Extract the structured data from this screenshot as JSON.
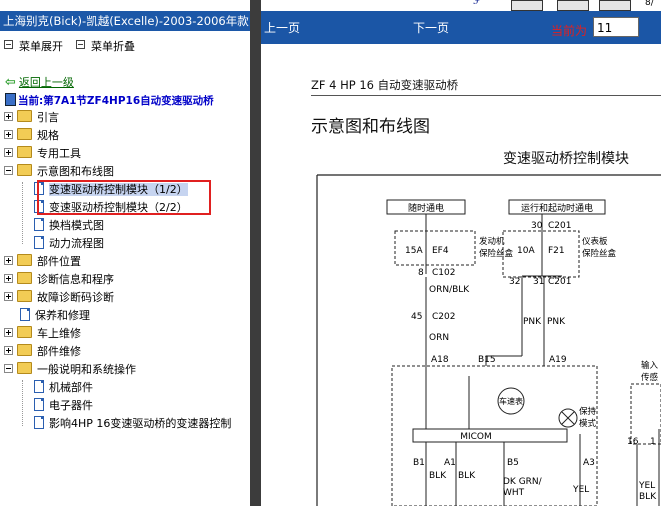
{
  "window_title": "上海别克(Bick)-凯越(Excelle)-2003-2006年款",
  "menu": {
    "expand": "菜单展开",
    "collapse": "菜单折叠"
  },
  "back_link": "返回上一级",
  "current": "当前:第7A1节ZF4HP16自动变速驱动桥",
  "tree": [
    {
      "label": "引言",
      "type": "folder",
      "expanded": false
    },
    {
      "label": "规格",
      "type": "folder",
      "expanded": false
    },
    {
      "label": "专用工具",
      "type": "folder",
      "expanded": false
    },
    {
      "label": "示意图和布线图",
      "type": "folder",
      "expanded": true
    },
    {
      "label": "变速驱动桥控制模块（1/2）",
      "type": "doc",
      "selected": true
    },
    {
      "label": "变速驱动桥控制模块（2/2）",
      "type": "doc"
    },
    {
      "label": "换档模式图",
      "type": "doc"
    },
    {
      "label": "动力流程图",
      "type": "doc"
    },
    {
      "label": "部件位置",
      "type": "folder",
      "expanded": false
    },
    {
      "label": "诊断信息和程序",
      "type": "folder",
      "expanded": false
    },
    {
      "label": "故障诊断码诊断",
      "type": "folder",
      "expanded": false
    },
    {
      "label": "保养和修理",
      "type": "doc-top"
    },
    {
      "label": "车上维修",
      "type": "folder",
      "expanded": false
    },
    {
      "label": "部件维修",
      "type": "folder",
      "expanded": false
    },
    {
      "label": "一般说明和系统操作",
      "type": "folder",
      "expanded": true
    },
    {
      "label": "机械部件",
      "type": "doc"
    },
    {
      "label": "电子器件",
      "type": "doc"
    },
    {
      "label": "影响4HP 16变速驱动桥的变速器控制",
      "type": "doc"
    }
  ],
  "nav": {
    "prev": "上一页",
    "next": "下一页",
    "current_label": "当前为",
    "page_value": "11",
    "top_right": "8/"
  },
  "document": {
    "header": "ZF 4 HP 16 自动变速驱动桥",
    "section_title": "示意图和布线图",
    "diagram_title": "变速驱动桥控制模块",
    "diagram": {
      "box_hot_run": "随时通电",
      "box_hot_run_start": "运行和起动时通电",
      "fuse_left_id": "15A",
      "fuse_left_name": "EF4",
      "fuse_left_desc_1": "发动机",
      "fuse_left_desc_2": "保险丝盒",
      "fuse_right_top_pin": "30",
      "fuse_right_top_conn": "C201",
      "fuse_right_id": "10A",
      "fuse_right_name": "F21",
      "fuse_right_desc_1": "仪表板",
      "fuse_right_desc_2": "保险丝盒",
      "left_pin_8": "8",
      "left_conn_c102": "C102",
      "wire_orn_blk": "ORN/BLK",
      "pin_45": "45",
      "conn_c202": "C202",
      "wire_orn": "ORN",
      "pin_32": "32",
      "pin_31": "31",
      "conn_c201_b": "C201",
      "wire_pnk_a": "PNK",
      "wire_pnk_b": "PNK",
      "term_a18": "A18",
      "term_b15": "B15",
      "term_a19": "A19",
      "speedometer": "车速表",
      "hold_mode_1": "保持",
      "hold_mode_2": "模式",
      "micom": "MICOM",
      "term_b1": "B1",
      "term_a1": "A1",
      "term_b5": "B5",
      "term_a3": "A3",
      "wire_blk_1": "BLK",
      "wire_blk_2": "BLK",
      "wire_dkgrn": "DK GRN/",
      "wire_wht": "WHT",
      "wire_yel": "YEL",
      "right_input_1": "输入",
      "right_input_2": "传感",
      "right_pin_16": "16",
      "right_pin_1": "1",
      "right_wire_yel": "YEL",
      "right_wire_blk": "BLK"
    }
  },
  "colors": {
    "title_bar": "#1c58a8",
    "nav_bar": "#1b56a6",
    "highlight_box": "#e02020",
    "current_label": "#e02020",
    "splitter": "#3c3c3c"
  }
}
